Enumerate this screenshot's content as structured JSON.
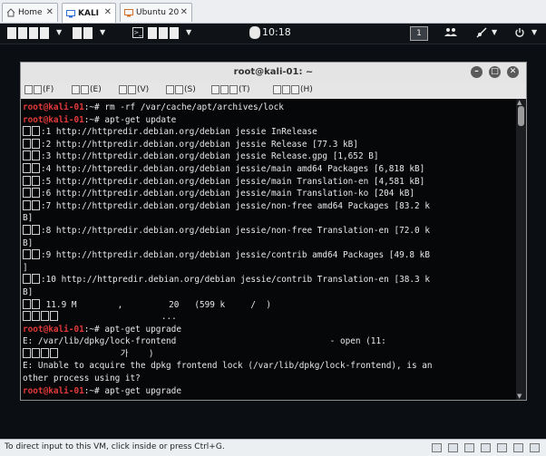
{
  "tabs": [
    {
      "label": "Home",
      "active": false
    },
    {
      "label": "KALI",
      "active": true
    },
    {
      "label": "Ubuntu 20",
      "active": false
    }
  ],
  "panel": {
    "time": "10:18",
    "workspace": "1"
  },
  "terminal": {
    "title": "root@kali-01: ~",
    "menu": [
      {
        "label": "(F)",
        "glyphs": 2
      },
      {
        "label": "(E)",
        "glyphs": 2
      },
      {
        "label": "(V)",
        "glyphs": 2
      },
      {
        "label": "(S)",
        "glyphs": 2
      },
      {
        "label": "(T)",
        "glyphs": 3
      },
      {
        "label": "(H)",
        "glyphs": 3
      }
    ],
    "lines": [
      {
        "type": "prompt",
        "prompt": "root@kali-01",
        "suffix": ":~# ",
        "text": "rm -rf /var/cache/apt/archives/lock"
      },
      {
        "type": "prompt",
        "prompt": "root@kali-01",
        "suffix": ":~# ",
        "text": "apt-get update"
      },
      {
        "type": "out",
        "glyphs": 2,
        "text": ":1 http://httpredir.debian.org/debian jessie InRelease"
      },
      {
        "type": "out",
        "glyphs": 2,
        "text": ":2 http://httpredir.debian.org/debian jessie Release [77.3 kB]"
      },
      {
        "type": "out",
        "glyphs": 2,
        "text": ":3 http://httpredir.debian.org/debian jessie Release.gpg [1,652 B]"
      },
      {
        "type": "out",
        "glyphs": 2,
        "text": ":4 http://httpredir.debian.org/debian jessie/main amd64 Packages [6,818 kB]"
      },
      {
        "type": "out",
        "glyphs": 2,
        "text": ":5 http://httpredir.debian.org/debian jessie/main Translation-en [4,581 kB]"
      },
      {
        "type": "out",
        "glyphs": 2,
        "text": ":6 http://httpredir.debian.org/debian jessie/main Translation-ko [204 kB]"
      },
      {
        "type": "out",
        "glyphs": 2,
        "text": ":7 http://httpredir.debian.org/debian jessie/non-free amd64 Packages [83.2 k"
      },
      {
        "type": "out",
        "glyphs": 0,
        "text": "B]"
      },
      {
        "type": "out",
        "glyphs": 2,
        "text": ":8 http://httpredir.debian.org/debian jessie/non-free Translation-en [72.0 k"
      },
      {
        "type": "out",
        "glyphs": 0,
        "text": "B]"
      },
      {
        "type": "out",
        "glyphs": 2,
        "text": ":9 http://httpredir.debian.org/debian jessie/contrib amd64 Packages [49.8 kB"
      },
      {
        "type": "out",
        "glyphs": 0,
        "text": "]"
      },
      {
        "type": "out",
        "glyphs": 2,
        "text": ":10 http://httpredir.debian.org/debian jessie/contrib Translation-en [38.3 k"
      },
      {
        "type": "out",
        "glyphs": 0,
        "text": "B]"
      },
      {
        "type": "out",
        "glyphs": 2,
        "text": " 11.9 M        ,         20   (599 k     /  )"
      },
      {
        "type": "out",
        "glyphs": 4,
        "text": "                    ...   "
      },
      {
        "type": "prompt",
        "prompt": "root@kali-01",
        "suffix": ":~# ",
        "text": "apt-get upgrade"
      },
      {
        "type": "out",
        "glyphs": 0,
        "text": "E: /var/lib/dpkg/lock-frontend                              - open (11:     "
      },
      {
        "type": "out",
        "glyphs": 4,
        "text": "            가    )"
      },
      {
        "type": "out",
        "glyphs": 0,
        "text": "E: Unable to acquire the dpkg frontend lock (/var/lib/dpkg/lock-frontend), is an"
      },
      {
        "type": "out",
        "glyphs": 0,
        "text": "other process using it?"
      },
      {
        "type": "prompt",
        "prompt": "root@kali-01",
        "suffix": ":~# ",
        "text": "apt-get upgrade"
      }
    ]
  },
  "status": {
    "message": "To direct input to this VM, click inside or press Ctrl+G."
  }
}
